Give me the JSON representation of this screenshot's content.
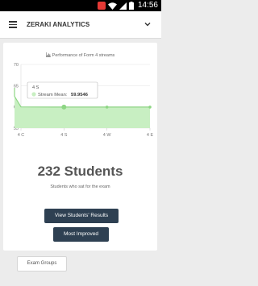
{
  "status_bar": {
    "time": "14:56"
  },
  "app_bar": {
    "title": "ZERAKI ANALYTICS"
  },
  "chart": {
    "title": "Performance of Form 4 streams"
  },
  "chart_data": {
    "type": "area",
    "categories": [
      "4 C",
      "4 S",
      "4 W",
      "4 E"
    ],
    "x_ticks": [
      "4 C",
      "4 S",
      "4 W",
      "4 E"
    ],
    "series": [
      {
        "name": "Stream Mean",
        "points": [
          [
            -0.6,
            64.5
          ],
          [
            -0.35,
            62.5
          ],
          [
            0,
            60
          ],
          [
            0.75,
            59.9546
          ],
          [
            1,
            59.9546
          ],
          [
            1.5,
            59.9546
          ],
          [
            2,
            59.9546
          ],
          [
            2.5,
            59.9546
          ],
          [
            3,
            59.9546
          ]
        ]
      }
    ],
    "ylim": [
      55,
      70
    ],
    "y_ticks": [
      55,
      60,
      65,
      70
    ],
    "tooltip": {
      "category": "4 S",
      "label": "Stream Mean:",
      "value": "59.9546"
    },
    "colors": {
      "fill": "#c8efc2",
      "line": "#8ed684",
      "grid": "#e6e6e6"
    }
  },
  "summary": {
    "count_text": "232 Students",
    "subtitle": "Students who sat for the exam"
  },
  "buttons": {
    "view_results": "View Students' Results",
    "most_improved": "Most Improved"
  },
  "footer": {
    "exam_groups": "Exam Groups"
  }
}
